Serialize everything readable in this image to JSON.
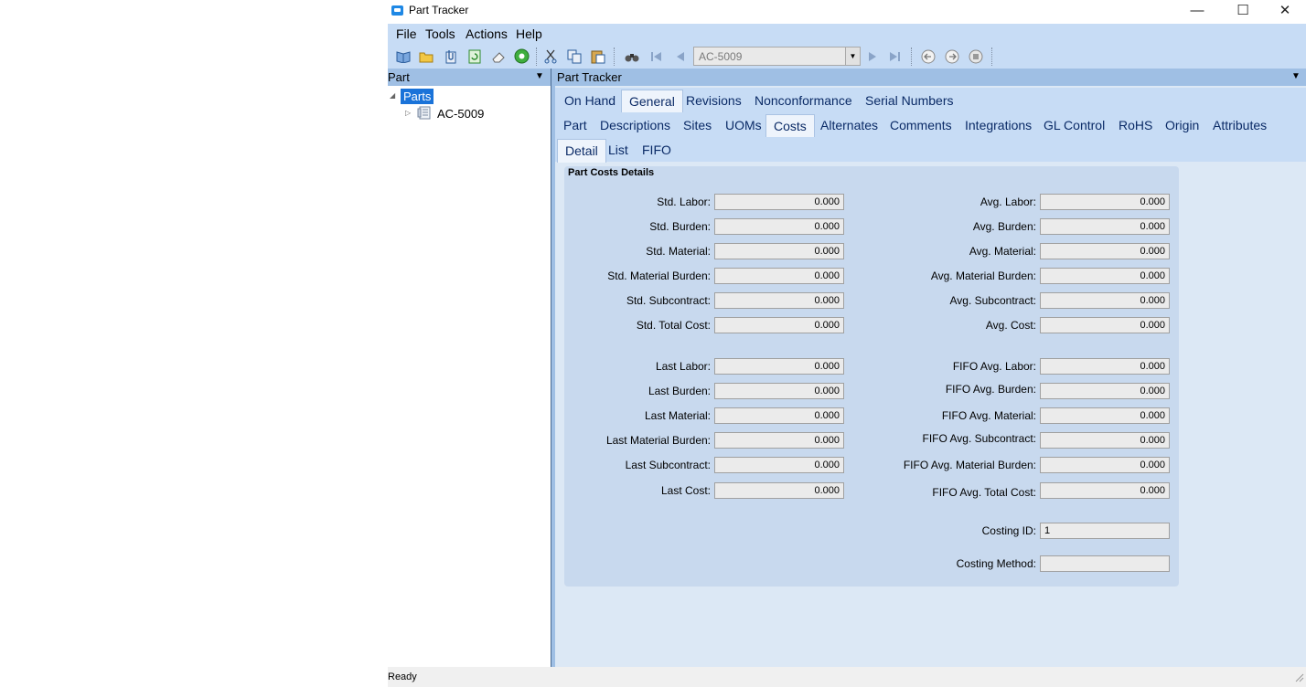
{
  "window": {
    "title": "Part Tracker"
  },
  "menu": [
    "File",
    "Tools",
    "Actions",
    "Help"
  ],
  "toolbar": {
    "part_combo_value": "AC-5009"
  },
  "left_panel": {
    "title": "Part",
    "tree_root": "Parts",
    "tree_child": "AC-5009"
  },
  "right_panel": {
    "title": "Part Tracker"
  },
  "tabs_top": [
    "On Hand",
    "General",
    "Revisions",
    "Nonconformance",
    "Serial Numbers"
  ],
  "tabs_general": [
    "Part",
    "Descriptions",
    "Sites",
    "UOMs",
    "Costs",
    "Alternates",
    "Comments",
    "Integrations",
    "GL Control",
    "RoHS",
    "Origin",
    "Attributes"
  ],
  "tabs_costs": [
    "Detail",
    "List",
    "FIFO"
  ],
  "group_title": "Part Costs Details",
  "left_fields": [
    {
      "label": "Std. Labor:",
      "value": "0.000"
    },
    {
      "label": "Std. Burden:",
      "value": "0.000"
    },
    {
      "label": "Std. Material:",
      "value": "0.000"
    },
    {
      "label": "Std. Material Burden:",
      "value": "0.000"
    },
    {
      "label": "Std. Subcontract:",
      "value": "0.000"
    },
    {
      "label": "Std. Total Cost:",
      "value": "0.000"
    },
    {
      "label": "Last Labor:",
      "value": "0.000"
    },
    {
      "label": "Last Burden:",
      "value": "0.000"
    },
    {
      "label": "Last Material:",
      "value": "0.000"
    },
    {
      "label": "Last Material Burden:",
      "value": "0.000"
    },
    {
      "label": "Last Subcontract:",
      "value": "0.000"
    },
    {
      "label": "Last Cost:",
      "value": "0.000"
    }
  ],
  "right_fields": [
    {
      "label": "Avg. Labor:",
      "value": "0.000"
    },
    {
      "label": "Avg. Burden:",
      "value": "0.000"
    },
    {
      "label": "Avg. Material:",
      "value": "0.000"
    },
    {
      "label": "Avg. Material Burden:",
      "value": "0.000"
    },
    {
      "label": "Avg. Subcontract:",
      "value": "0.000"
    },
    {
      "label": "Avg. Cost:",
      "value": "0.000"
    },
    {
      "label": "FIFO Avg. Labor:",
      "value": "0.000"
    },
    {
      "label": "FIFO Avg. Burden:",
      "value": "0.000"
    },
    {
      "label": "FIFO Avg. Material:",
      "value": "0.000"
    },
    {
      "label": "FIFO Avg. Subcontract:",
      "value": "0.000"
    },
    {
      "label": "FIFO Avg. Material Burden:",
      "value": "0.000"
    },
    {
      "label": "FIFO Avg. Total Cost:",
      "value": "0.000"
    }
  ],
  "costing_id": {
    "label": "Costing ID:",
    "value": "1"
  },
  "costing_method": {
    "label": "Costing Method:",
    "value": ""
  },
  "status": "Ready"
}
